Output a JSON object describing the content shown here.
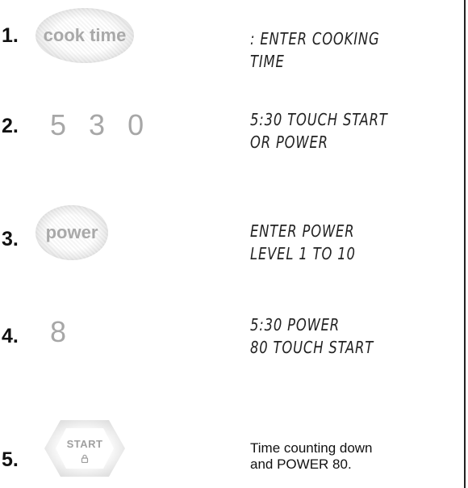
{
  "steps": [
    {
      "number": "1.",
      "key": "cook time",
      "display_lines": [
        ": ENTER COOKING TIME"
      ]
    },
    {
      "number": "2.",
      "digits": [
        "5",
        "3",
        "0"
      ],
      "display_lines": [
        "5:30 TOUCH START",
        "OR POWER"
      ]
    },
    {
      "number": "3.",
      "key": "power",
      "display_lines": [
        "ENTER POWER",
        "LEVEL 1 TO 10"
      ]
    },
    {
      "number": "4.",
      "digits": [
        "8"
      ],
      "display_lines": [
        "5:30 POWER",
        "80 TOUCH START"
      ]
    },
    {
      "number": "5.",
      "key": "START",
      "key_icon": "lock-icon",
      "text_lines": [
        "Time counting down",
        "and POWER 80."
      ]
    }
  ]
}
